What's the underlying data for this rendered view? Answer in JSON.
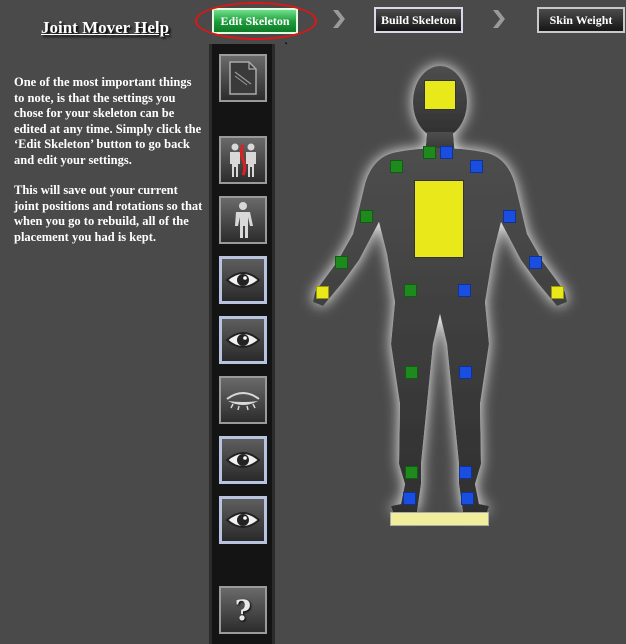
{
  "help": {
    "title": "Joint Mover Help",
    "paragraph1": "One of the most important things to note, is that the settings you chose for your skeleton can be edited at any time. Simply click the ‘Edit Skeleton’ button to go back and edit your settings.",
    "paragraph2": "This will save out your current joint positions and rotations so that when you go to rebuild, all of the placement you had is kept."
  },
  "steps": {
    "edit_skeleton": "Edit Skeleton",
    "build_skeleton": "Build Skeleton",
    "skin_weight": "Skin Weight"
  },
  "toolbar": {
    "items": [
      "template-icon",
      "mirror-body-icon",
      "body-icon",
      "eye-icon",
      "eye-icon",
      "closed-eye-icon",
      "eye-icon",
      "eye-icon",
      "help-icon"
    ],
    "help_label": "?"
  },
  "colors": {
    "active_step": "#1b9b3a",
    "annotation": "#e01515",
    "joint_green": "#1e8a1e",
    "joint_blue": "#1a4ee0",
    "joint_yellow": "#e8e81a"
  }
}
